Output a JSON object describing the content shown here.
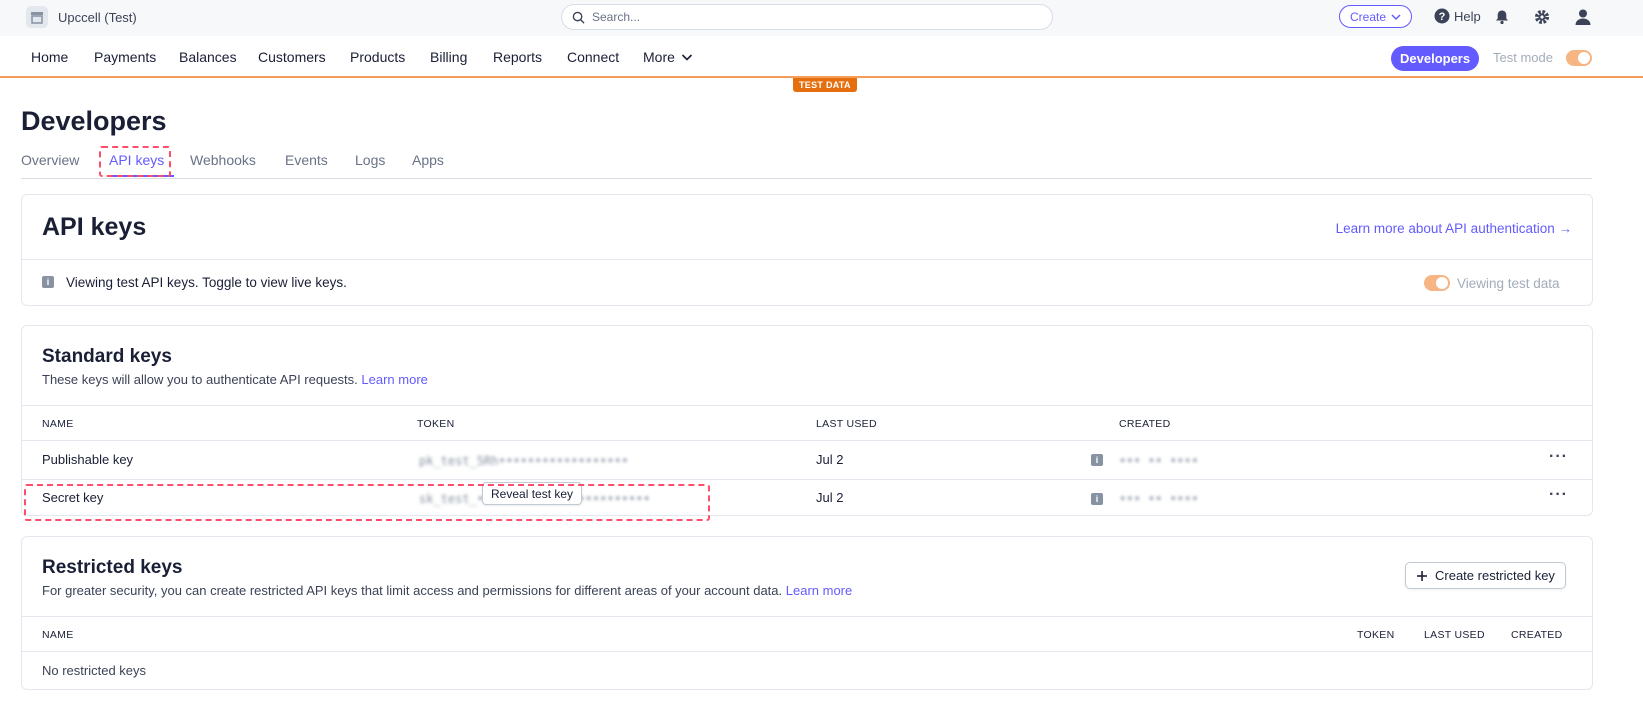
{
  "topbar": {
    "account_name": "Upccell (Test)",
    "search_placeholder": "Search...",
    "create_label": "Create",
    "help_label": "Help"
  },
  "nav": {
    "items": [
      "Home",
      "Payments",
      "Balances",
      "Customers",
      "Products",
      "Billing",
      "Reports",
      "Connect",
      "More"
    ],
    "developers_label": "Developers",
    "test_mode_label": "Test mode",
    "test_data_badge": "TEST DATA"
  },
  "page": {
    "title": "Developers",
    "tabs": [
      "Overview",
      "API keys",
      "Webhooks",
      "Events",
      "Logs",
      "Apps"
    ],
    "active_tab": "API keys"
  },
  "api_keys": {
    "title": "API keys",
    "learn_more_auth": "Learn more about API authentication →",
    "notice": "Viewing test API keys. Toggle to view live keys.",
    "viewing_test_data": "Viewing test data"
  },
  "standard_keys": {
    "title": "Standard keys",
    "description": "These keys will allow you to authenticate API requests.",
    "learn_more": "Learn more",
    "columns": [
      "NAME",
      "TOKEN",
      "LAST USED",
      "CREATED"
    ],
    "rows": [
      {
        "name": "Publishable key",
        "token": "pk_test_5Rh••••••••••••••••••",
        "last_used": "Jul 2",
        "created": "••• •• ••••"
      },
      {
        "name": "Secret key",
        "token": "sk_test_••••••••••••••••••••••••",
        "last_used": "Jul 2",
        "created": "••• •• ••••"
      }
    ],
    "reveal_label": "Reveal test key"
  },
  "restricted_keys": {
    "title": "Restricted keys",
    "description": "For greater security, you can create restricted API keys that limit access and permissions for different areas of your account data.",
    "learn_more": "Learn more",
    "create_label": "Create restricted key",
    "columns": [
      "NAME",
      "TOKEN",
      "LAST USED",
      "CREATED"
    ],
    "empty": "No restricted keys"
  },
  "colors": {
    "accent": "#635bff",
    "test_orange": "#e56f0f",
    "toggle": "#f6b583"
  }
}
